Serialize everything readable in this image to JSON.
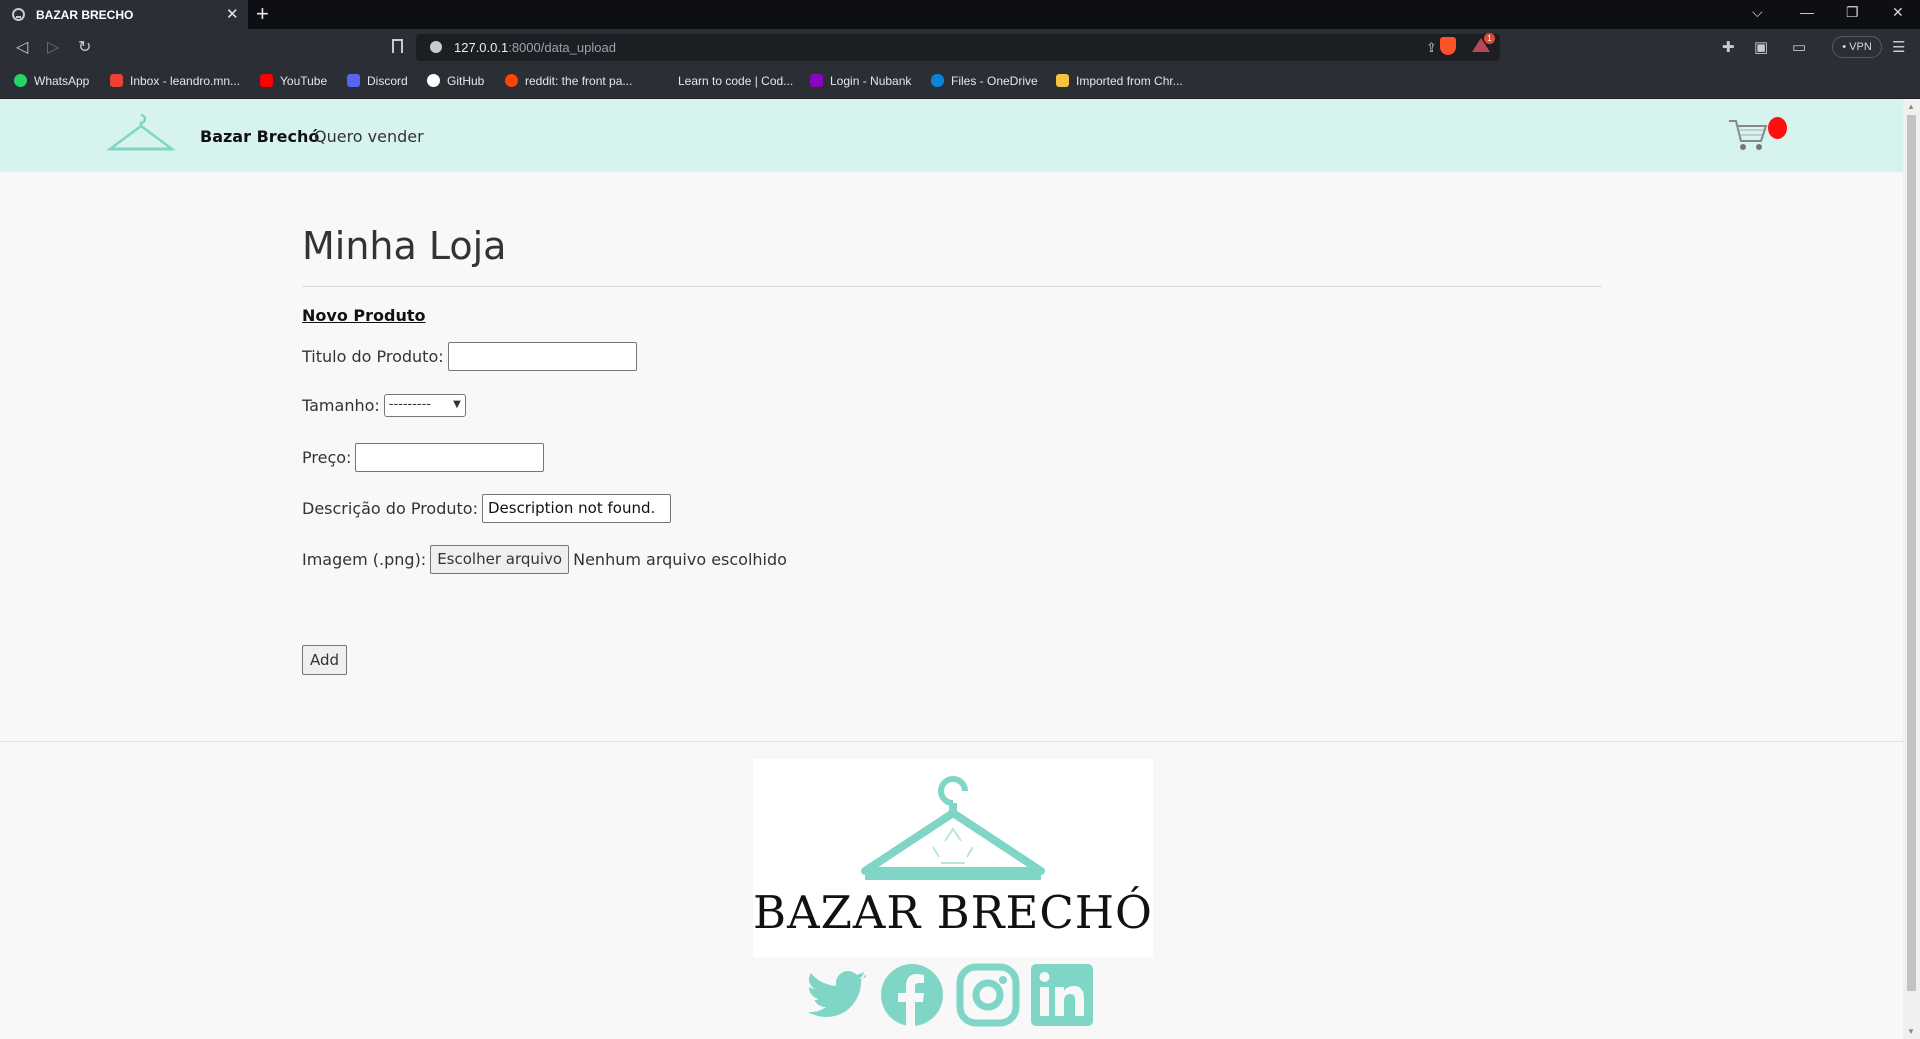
{
  "browser": {
    "tab_title": "BAZAR BRECHO",
    "tab_close": "✕",
    "new_tab": "+",
    "url_host": "127.0.0.1",
    "url_rest": ":8000/data_upload",
    "vpn_label": "• VPN",
    "rewards_count": "1",
    "window_controls": [
      "⌵",
      "—",
      "❐",
      "✕"
    ]
  },
  "bookmarks": [
    {
      "label": "WhatsApp",
      "color": "#25d366"
    },
    {
      "label": "Inbox - leandro.mn...",
      "color": "#ea4335"
    },
    {
      "label": "YouTube",
      "color": "#ff0000"
    },
    {
      "label": "Discord",
      "color": "#5865f2"
    },
    {
      "label": "GitHub",
      "color": "#ffffff"
    },
    {
      "label": "reddit: the front pa...",
      "color": "#ff4500"
    },
    {
      "label": "Learn to code | Cod...",
      "color": "#2b2e35"
    },
    {
      "label": "Login - Nubank",
      "color": "#8a05be"
    },
    {
      "label": "Files - OneDrive",
      "color": "#0a84d6"
    },
    {
      "label": "Imported from Chr...",
      "color": "#f5c242"
    }
  ],
  "site": {
    "brand": "Bazar Brechó",
    "sell_link": "Quero vender",
    "accent": "#7fd6c6",
    "nav_bg": "#d7f3ee"
  },
  "form": {
    "page_title": "Minha Loja",
    "section_title": "Novo Produto",
    "title_label": "Titulo do Produto:",
    "title_value": "",
    "size_label": "Tamanho:",
    "size_selected": "---------",
    "price_label": "Preço:",
    "price_value": "",
    "description_label": "Descrição do Produto:",
    "description_value": "Description not found.",
    "image_label": "Imagem (.png):",
    "file_button": "Escolher arquivo",
    "file_status": "Nenhum arquivo escolhido",
    "submit": "Add"
  },
  "footer": {
    "logo_text": "BAZAR BRECHÓ",
    "social": [
      "twitter-icon",
      "facebook-icon",
      "instagram-icon",
      "linkedin-icon"
    ]
  }
}
